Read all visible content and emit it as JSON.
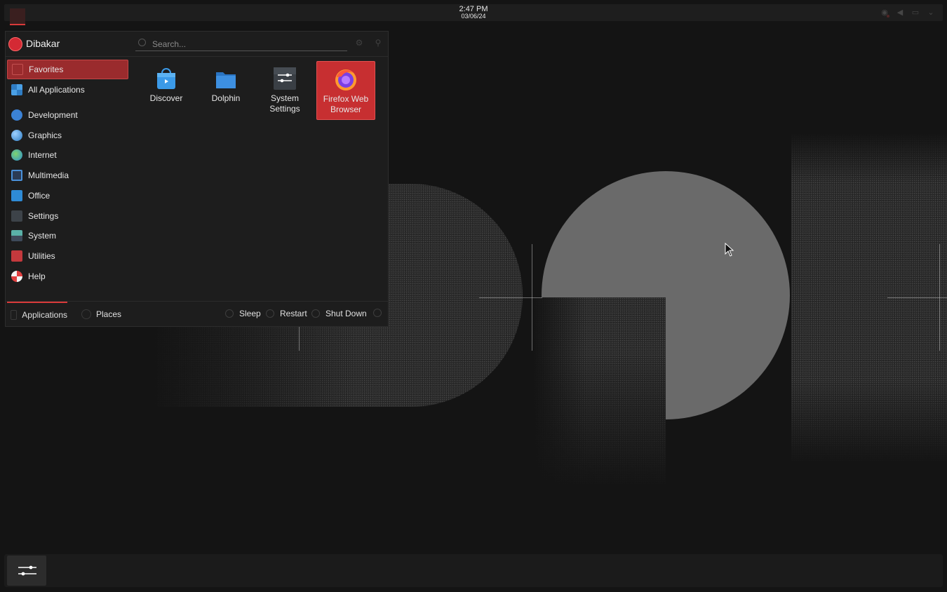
{
  "panel": {
    "time": "2:47 PM",
    "date": "03/06/24",
    "launcher_icon": "app-launcher-icon",
    "tray_icons": [
      "network-icon",
      "volume-icon",
      "display-icon",
      "chevron-down-icon"
    ]
  },
  "launcher": {
    "user": "Dibakar",
    "search_placeholder": "Search...",
    "header_buttons": [
      "configure-icon",
      "pin-icon"
    ],
    "categories": [
      {
        "label": "Favorites",
        "icon": "favorites-icon",
        "active": true
      },
      {
        "label": "All Applications",
        "icon": "grid-icon"
      },
      {
        "label": "Development",
        "icon": "development-icon"
      },
      {
        "label": "Graphics",
        "icon": "graphics-icon"
      },
      {
        "label": "Internet",
        "icon": "globe-icon"
      },
      {
        "label": "Multimedia",
        "icon": "multimedia-icon"
      },
      {
        "label": "Office",
        "icon": "office-icon"
      },
      {
        "label": "Settings",
        "icon": "settings-icon"
      },
      {
        "label": "System",
        "icon": "system-icon"
      },
      {
        "label": "Utilities",
        "icon": "toolbox-icon"
      },
      {
        "label": "Help",
        "icon": "help-icon"
      }
    ],
    "favorites": [
      {
        "label": "Discover",
        "icon": "discover-icon"
      },
      {
        "label": "Dolphin",
        "icon": "folder-icon"
      },
      {
        "label": "System Settings",
        "icon": "system-settings-icon"
      },
      {
        "label": "Firefox Web Browser",
        "icon": "firefox-icon",
        "selected": true
      }
    ],
    "footer": {
      "tabs": [
        "Applications",
        "Places"
      ],
      "power": [
        "Sleep",
        "Restart",
        "Shut Down"
      ]
    }
  },
  "taskbar": {
    "tasks": [
      {
        "icon": "system-settings-icon"
      }
    ]
  },
  "colors": {
    "accent": "#c72f31",
    "background": "#141414",
    "panel": "#1e1e1e"
  }
}
